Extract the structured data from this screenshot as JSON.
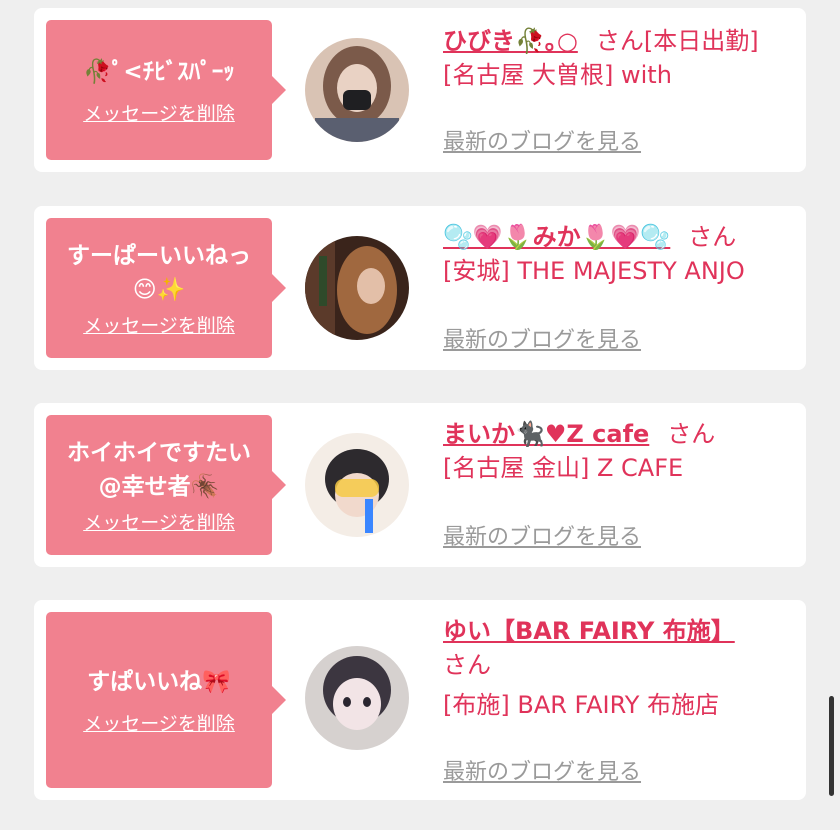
{
  "items": [
    {
      "message": "🥀ﾟ<ﾁﾋﾞｽﾊﾟｰｯ",
      "delete_label": "メッセージを削除",
      "name": "ひびき🥀｡○",
      "honorific": "さん",
      "status": "[本日出勤]",
      "shop": "[名古屋 大曽根] with",
      "blog_label": "最新のブログを見る",
      "avatar_colors": [
        "#d9c3b4",
        "#7b5a4a"
      ]
    },
    {
      "message": "すーぱーいいねっ😊✨",
      "delete_label": "メッセージを削除",
      "name": "🫧💗🌷みか🌷💗🫧",
      "honorific": "さん",
      "shop": "[安城] THE MAJESTY ANJO",
      "blog_label": "最新のブログを見る",
      "avatar_colors": [
        "#a0683f",
        "#3a241b"
      ]
    },
    {
      "message": "ホイホイですたい@幸せ者🪳",
      "delete_label": "メッセージを削除",
      "name": "まいか🐈‍⬛♥Z cafe",
      "honorific": "さん",
      "shop": "[名古屋 金山] Z CAFE",
      "blog_label": "最新のブログを見る",
      "avatar_colors": [
        "#f4ede6",
        "#2d2a2e"
      ]
    },
    {
      "message": "すぱいいね🎀",
      "delete_label": "メッセージを削除",
      "name": "ゆい【BAR FAIRY 布施】",
      "honorific": "さん",
      "shop": "[布施] BAR FAIRY 布施店",
      "blog_label": "最新のブログを見る",
      "avatar_colors": [
        "#d6d1cf",
        "#3c3640"
      ]
    }
  ]
}
